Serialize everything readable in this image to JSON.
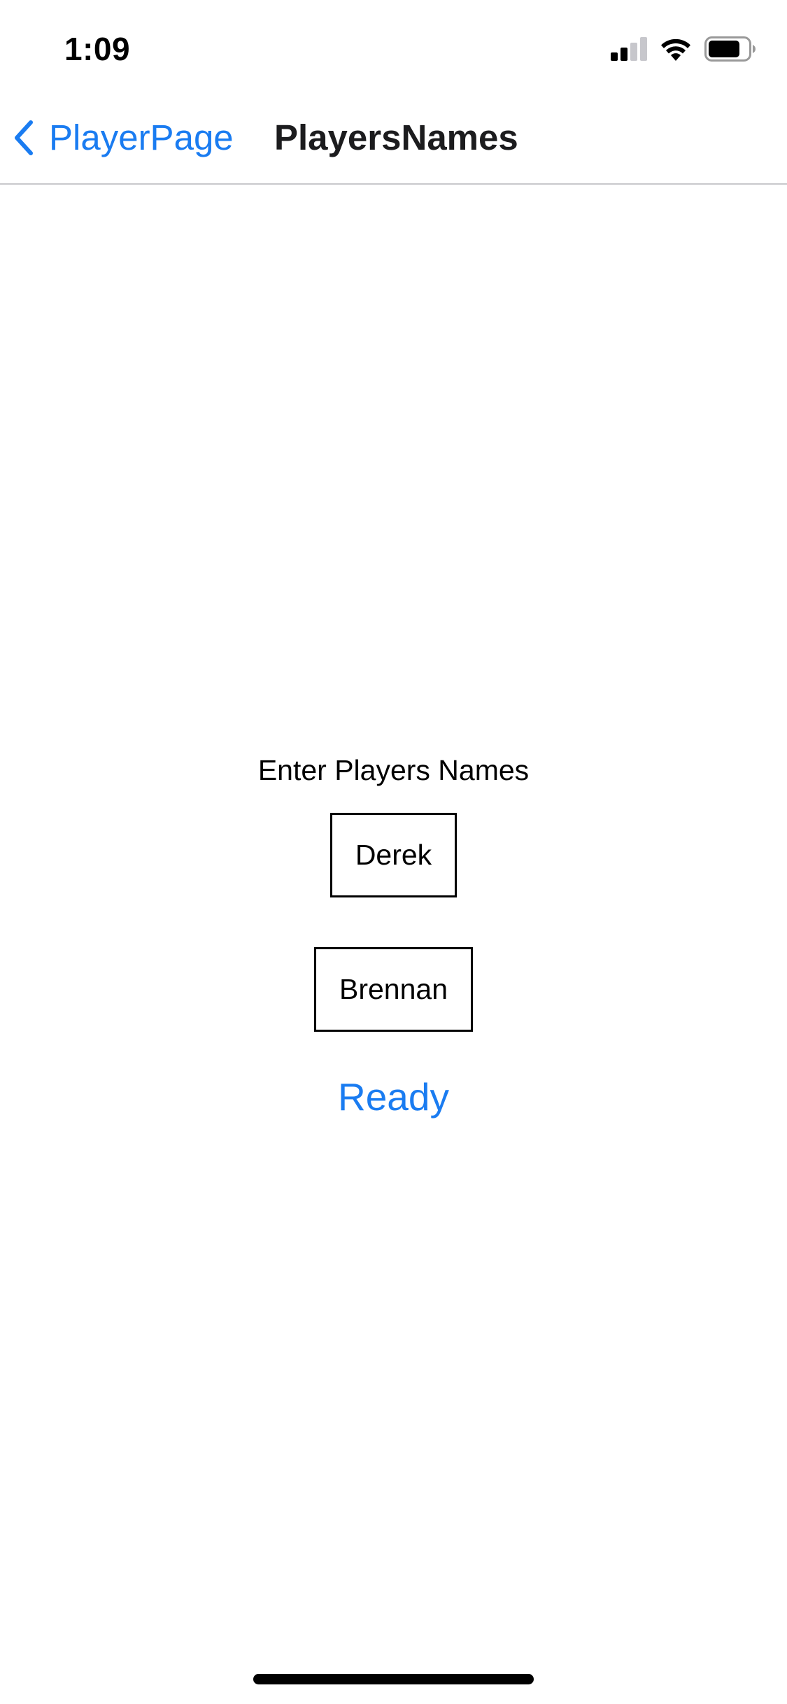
{
  "status_bar": {
    "time": "1:09",
    "icons": [
      "signal-icon",
      "wifi-icon",
      "battery-icon"
    ]
  },
  "nav": {
    "back_label": "PlayerPage",
    "title": "PlayersNames",
    "accent_color": "#1a7cf1"
  },
  "content": {
    "prompt": "Enter Players Names",
    "player_fields": [
      {
        "value": "Derek"
      },
      {
        "value": "Brennan"
      }
    ],
    "ready_label": "Ready"
  }
}
